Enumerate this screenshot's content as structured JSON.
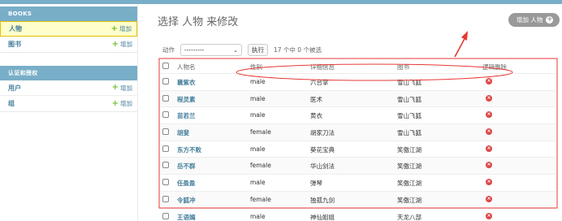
{
  "sidebar": {
    "modules": [
      {
        "caption": "BOOKS",
        "rows": [
          {
            "label": "人物",
            "add": "增加",
            "active": true
          },
          {
            "label": "图书",
            "add": "增加",
            "active": false
          }
        ]
      },
      {
        "caption": "认证和授权",
        "rows": [
          {
            "label": "用户",
            "add": "增加",
            "active": false
          },
          {
            "label": "组",
            "add": "增加",
            "active": false
          }
        ]
      }
    ]
  },
  "main": {
    "title": "选择 人物 来修改",
    "add_button": "增加 人物",
    "actions": {
      "label": "动作",
      "select_value": "---------",
      "go": "执行",
      "count": "17 个中 0 个被选"
    },
    "table": {
      "headers": [
        "人物名",
        "性别",
        "详细信息",
        "图书",
        "逻辑删除"
      ],
      "rows": [
        [
          "襄紫衣",
          "male",
          "六合掌",
          "雪山飞狐"
        ],
        [
          "程灵素",
          "male",
          "医术",
          "雪山飞狐"
        ],
        [
          "苗若兰",
          "male",
          "黄衣",
          "雪山飞狐"
        ],
        [
          "胡斐",
          "female",
          "胡家刀法",
          "雪山飞狐"
        ],
        [
          "东方不败",
          "male",
          "葵花宝典",
          "笑傲江湖"
        ],
        [
          "岳不群",
          "female",
          "华山剑法",
          "笑傲江湖"
        ],
        [
          "任盈盈",
          "male",
          "弹琴",
          "笑傲江湖"
        ],
        [
          "令狐冲",
          "female",
          "独孤九剑",
          "笑傲江湖"
        ],
        [
          "王语嫣",
          "male",
          "神仙姐姐",
          "天龙八部"
        ]
      ]
    }
  },
  "colors": {
    "header": "#79aec8",
    "link": "#447e9b",
    "add_plus": "#70bf2b",
    "delete": "#dd4646",
    "annotation": "#e53935"
  }
}
